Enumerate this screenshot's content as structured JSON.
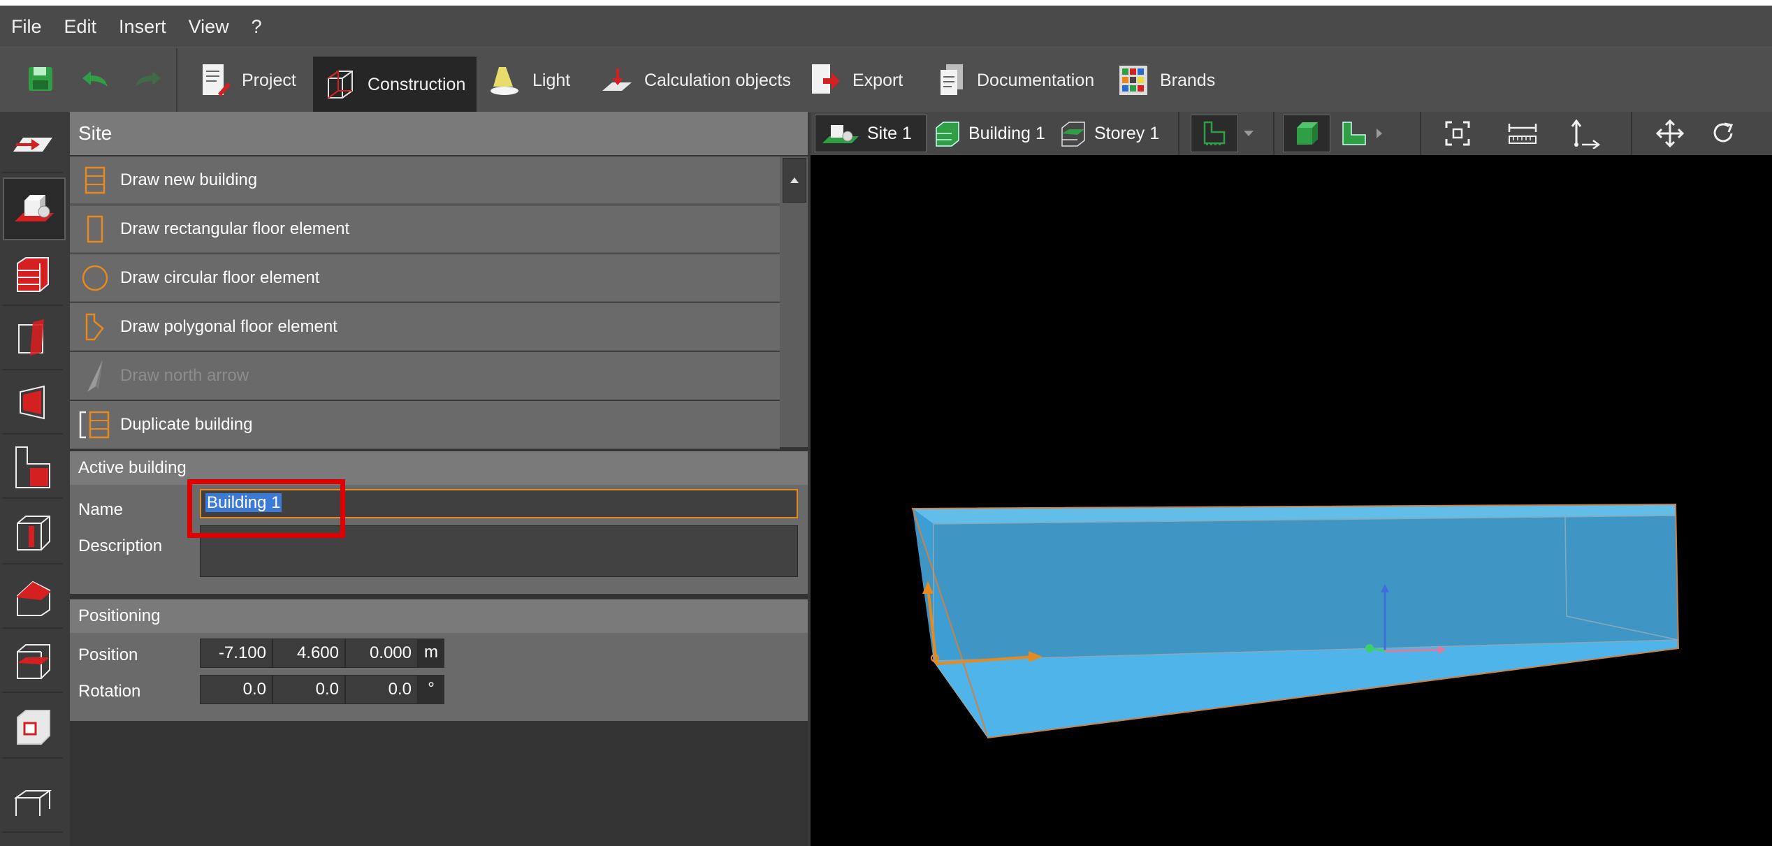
{
  "menu": [
    "File",
    "Edit",
    "Insert",
    "View",
    "?"
  ],
  "toolbar": {
    "tabs": [
      {
        "label": "Project",
        "icon": "project-icon"
      },
      {
        "label": "Construction",
        "icon": "construction-icon"
      },
      {
        "label": "Light",
        "icon": "light-icon"
      },
      {
        "label": "Calculation objects",
        "icon": "calculation-objects-icon"
      },
      {
        "label": "Export",
        "icon": "export-icon"
      },
      {
        "label": "Documentation",
        "icon": "documentation-icon"
      },
      {
        "label": "Brands",
        "icon": "brands-icon"
      }
    ],
    "active_tab": "Construction"
  },
  "panel": {
    "site_header": "Site",
    "commands": [
      {
        "label": "Draw new building",
        "icon": "building-icon",
        "enabled": true
      },
      {
        "label": "Draw rectangular floor element",
        "icon": "rectangle-icon",
        "enabled": true
      },
      {
        "label": "Draw circular floor element",
        "icon": "circle-icon",
        "enabled": true
      },
      {
        "label": "Draw polygonal floor element",
        "icon": "polygon-icon",
        "enabled": true
      },
      {
        "label": "Draw north arrow",
        "icon": "north-arrow-icon",
        "enabled": false
      },
      {
        "label": "Duplicate building",
        "icon": "duplicate-icon",
        "enabled": true
      }
    ],
    "active_building": {
      "header": "Active building",
      "name_label": "Name",
      "name_value": "Building 1",
      "description_label": "Description",
      "description_value": ""
    },
    "positioning": {
      "header": "Positioning",
      "position_label": "Position",
      "position": [
        "-7.100",
        "4.600",
        "0.000"
      ],
      "position_unit": "m",
      "rotation_label": "Rotation",
      "rotation": [
        "0.0",
        "0.0",
        "0.0"
      ],
      "rotation_unit": "°"
    }
  },
  "viewport": {
    "breadcrumbs": [
      "Site 1",
      "Building 1",
      "Storey 1"
    ]
  },
  "colors": {
    "accent": "#e8891f",
    "box": "#4ab0e6",
    "highlight": "#e00000",
    "selection": "#3d7ad6"
  }
}
